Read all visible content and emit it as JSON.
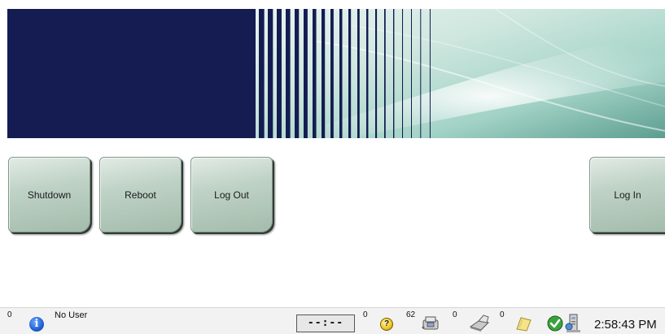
{
  "buttons": {
    "shutdown": "Shutdown",
    "reboot": "Reboot",
    "logout": "Log Out",
    "login": "Log In"
  },
  "status_bar": {
    "alert_count": "0",
    "user": "No User",
    "timer": "--:--",
    "help_count": "0",
    "scanner_count": "62",
    "printer_count": "0",
    "notes_count": "0",
    "time": "2:58:43 PM"
  },
  "icons": {
    "alert": "info-icon",
    "help": "question-icon",
    "scanner": "scanner-icon",
    "printer": "printer-icon",
    "notes": "notes-icon",
    "status": "check-icon",
    "system": "system-icon"
  },
  "colors": {
    "banner_navy": "#141c52",
    "banner_teal": "#9fd3c4",
    "button_green": "#bfd2c6"
  }
}
